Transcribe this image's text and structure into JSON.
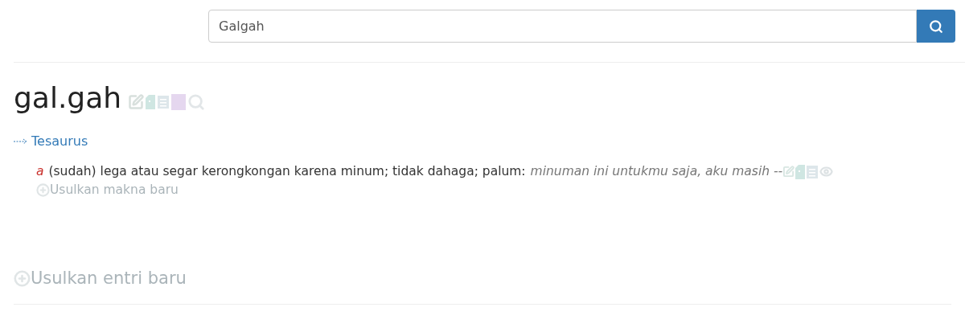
{
  "search": {
    "value": "Galgah"
  },
  "entry": {
    "headword": "gal.gah",
    "thesaurus_link": "Tesaurus",
    "definitions": [
      {
        "class_label": "a",
        "text": "(sudah) lega atau segar kerongkongan karena minum; tidak dahaga; palum:",
        "example": "minuman ini untukmu saja, aku masih --"
      }
    ],
    "suggest_meaning": "Usulkan makna baru"
  },
  "suggest_entry": "Usulkan entri baru"
}
